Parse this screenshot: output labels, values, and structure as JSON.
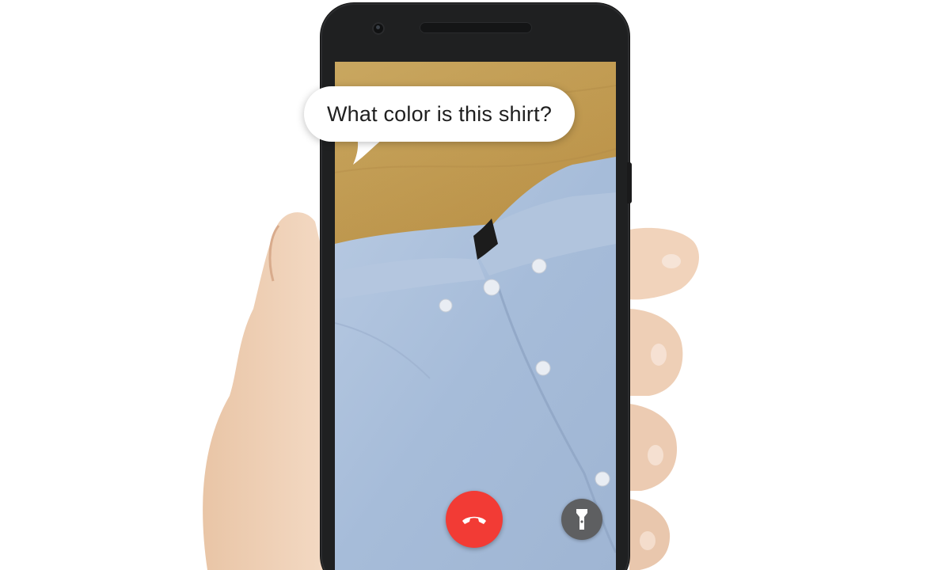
{
  "speech_bubble": {
    "text": "What color is this shirt?"
  },
  "call_controls": {
    "end_call_icon": "phone-hangup-icon",
    "flashlight_icon": "flashlight-icon"
  },
  "colors": {
    "end_call": "#f23b35",
    "flashlight_bg": "#5e5f61",
    "shirt": "#a9bfdc",
    "table": "#c09a52",
    "phone_body": "#1f2021"
  }
}
